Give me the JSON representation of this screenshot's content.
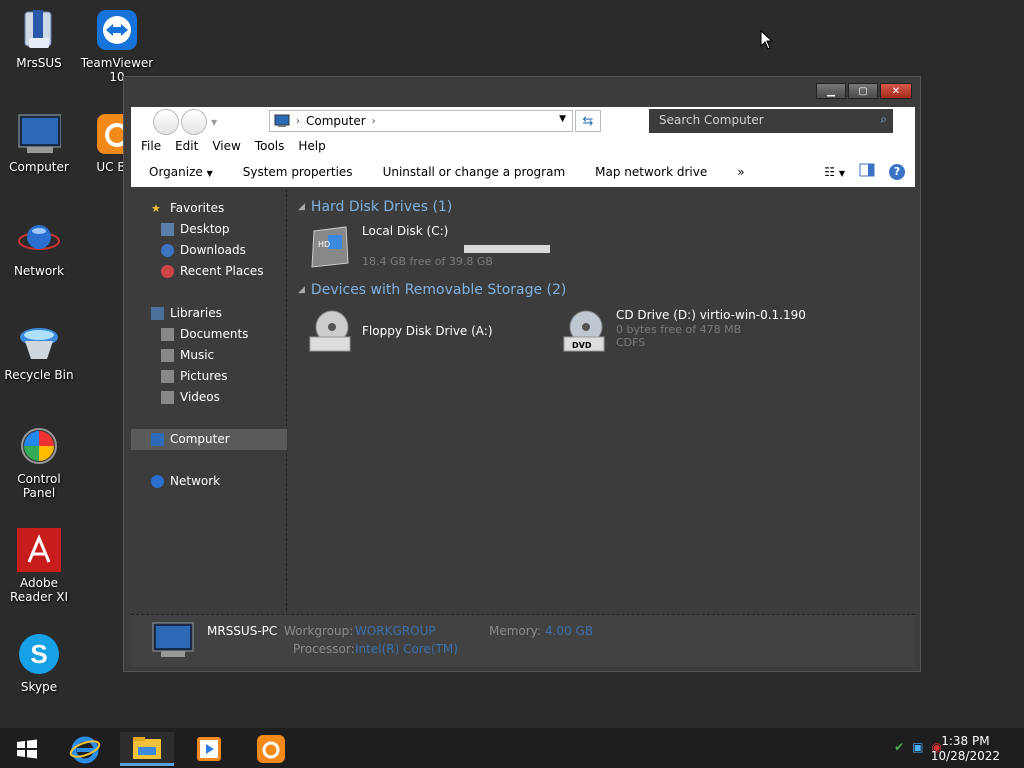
{
  "desktop_icons": [
    {
      "id": "mrssus",
      "label": "MrsSUS"
    },
    {
      "id": "teamviewer",
      "label": "TeamViewer 10"
    },
    {
      "id": "computer",
      "label": "Computer"
    },
    {
      "id": "ucbrowser",
      "label": "UC Bro"
    },
    {
      "id": "network",
      "label": "Network"
    },
    {
      "id": "recyclebin",
      "label": "Recycle Bin"
    },
    {
      "id": "controlpanel",
      "label": "Control Panel"
    },
    {
      "id": "adobereader",
      "label": "Adobe Reader XI"
    },
    {
      "id": "skype",
      "label": "Skype"
    }
  ],
  "window": {
    "address": {
      "location": "Computer"
    },
    "search": {
      "placeholder": "Search Computer"
    },
    "menu": [
      "File",
      "Edit",
      "View",
      "Tools",
      "Help"
    ],
    "commands": [
      "Organize",
      "System properties",
      "Uninstall or change a program",
      "Map network drive",
      "»"
    ],
    "nav": {
      "favorites": "Favorites",
      "desktop": "Desktop",
      "downloads": "Downloads",
      "recent": "Recent Places",
      "libraries": "Libraries",
      "documents": "Documents",
      "music": "Music",
      "pictures": "Pictures",
      "videos": "Videos",
      "computer": "Computer",
      "network": "Network"
    },
    "groups": {
      "hdd": "Hard Disk Drives (1)",
      "removable": "Devices with Removable Storage (2)"
    },
    "drives": {
      "c": {
        "name": "Local Disk (C:)",
        "free": "18.4 GB free of 39.8 GB",
        "used_fraction": 0.54
      },
      "a": {
        "name": "Floppy Disk Drive (A:)"
      },
      "d": {
        "name": "CD Drive (D:) virtio-win-0.1.190",
        "free": "0 bytes free of 478 MB",
        "fs": "CDFS"
      }
    },
    "details": {
      "pc_name": "MRSSUS-PC",
      "workgroup_label": "Workgroup:",
      "workgroup_value": "WORKGROUP",
      "memory_label": "Memory:",
      "memory_value": "4.00 GB",
      "processor_label": "Processor:",
      "processor_value": "Intel(R) Core(TM)"
    }
  },
  "taskbar": {
    "time": "1:38 PM",
    "date": "10/28/2022"
  },
  "colors": {
    "accent": "#56a3e0",
    "group_header": "#7fb0df"
  }
}
